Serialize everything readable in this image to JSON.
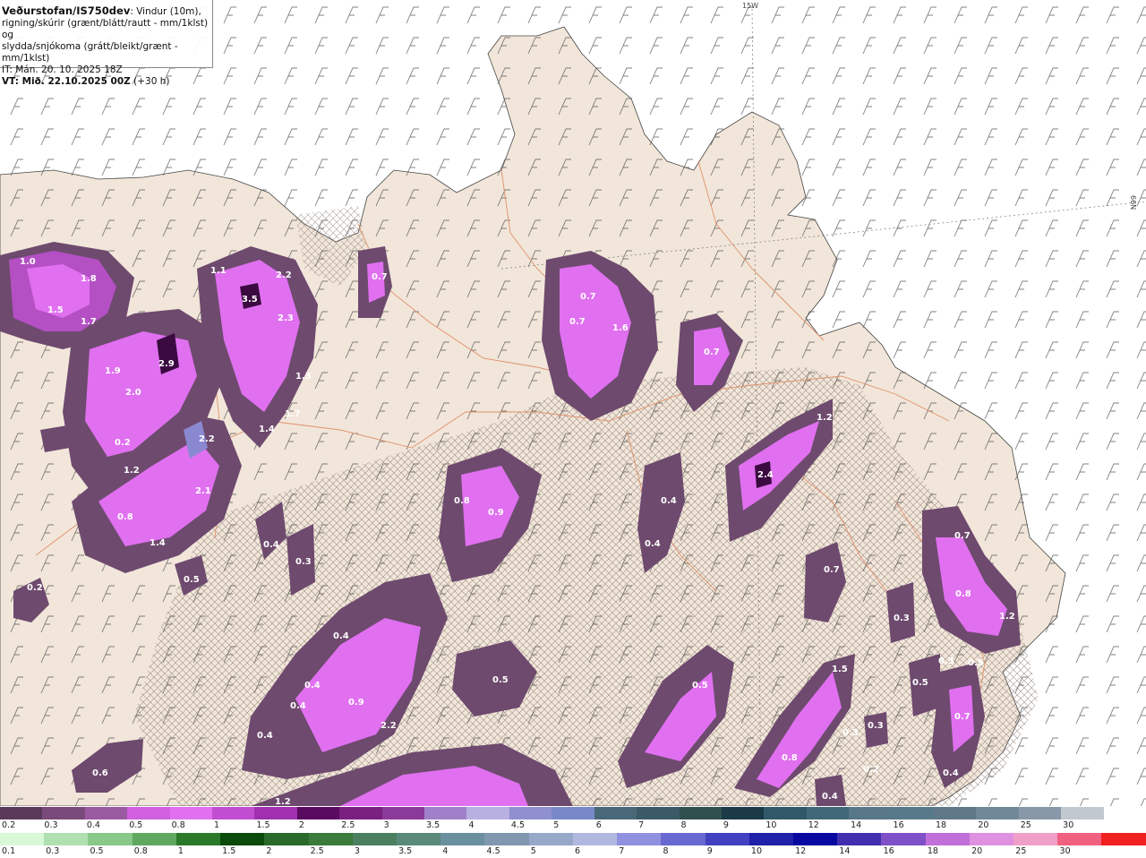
{
  "header": {
    "brand": "Veðurstofan/IS750dev",
    "desc_line1": ": Vindur (10m),",
    "desc_line2": "rigning/skúrir (grænt/blátt/rautt - mm/1klst) og",
    "desc_line3": "slydda/snjókoma (grátt/bleikt/grænt - mm/1klst)",
    "it_line": "IT: Mán. 20. 10. 2025 18Z",
    "vt_line": "VT: Mið. 22.10.2025 00Z",
    "lead": " (+30 h)"
  },
  "graticule": {
    "lon": "15W",
    "lat": "66N"
  },
  "colors": {
    "sea": "#ffffff",
    "land": "#f2e6da",
    "coast_land": "#e8d2bf",
    "roads": "#e0906a",
    "precip_light": "#6e4a6e",
    "precip_mid": "#a050a8",
    "precip_high": "#e060f0",
    "precip_peak": "#3a0a40"
  },
  "legend_precip": {
    "labels": [
      "0.2",
      "0.3",
      "0.4",
      "0.5",
      "0.8",
      "1",
      "1.5",
      "2",
      "2.5",
      "3",
      "3.5",
      "4",
      "4.5",
      "5",
      "6",
      "7",
      "8",
      "9",
      "10",
      "12",
      "14",
      "16",
      "18",
      "20",
      "25",
      "30"
    ],
    "colors": [
      "#5a3a5a",
      "#7a4a7a",
      "#9a5aa0",
      "#d060e0",
      "#e070f0",
      "#c04ed0",
      "#a030b0",
      "#5a0a60",
      "#7a2080",
      "#8a3a98",
      "#a080c8",
      "#b8b0e0",
      "#9090d0",
      "#7888c8",
      "#486878",
      "#3a5a68",
      "#305050",
      "#1a3a48",
      "#305868",
      "#406878",
      "#587888",
      "#587a88",
      "#607888",
      "#708898",
      "#8898a8",
      "#c0c8d0",
      "#ffffff"
    ]
  },
  "legend_rain": {
    "labels": [
      "0.1",
      "0.3",
      "0.5",
      "0.8",
      "1",
      "1.5",
      "2",
      "2.5",
      "3",
      "3.5",
      "4",
      "4.5",
      "5",
      "6",
      "7",
      "8",
      "9",
      "10",
      "12",
      "14",
      "16",
      "18",
      "20",
      "25",
      "30"
    ],
    "colors": [
      "#d8f8d8",
      "#b0e0b0",
      "#88c888",
      "#60a860",
      "#2a7a2a",
      "#0a4a0a",
      "#2a6a2a",
      "#3a7a3a",
      "#4a8060",
      "#5a8a7a",
      "#6a90a0",
      "#8098b0",
      "#98a8c8",
      "#b0b8e0",
      "#9090e0",
      "#6868d0",
      "#4040c0",
      "#2020a8",
      "#0808a0",
      "#4030b0",
      "#8050c8",
      "#c070d8",
      "#e090e0",
      "#f0a0c8",
      "#f06080",
      "#f02020"
    ]
  },
  "values": [
    {
      "label": "1.0"
    },
    {
      "label": "1.8"
    },
    {
      "label": "1.5"
    },
    {
      "label": "1.7"
    },
    {
      "label": "1.1"
    },
    {
      "label": "2.2"
    },
    {
      "label": "3.5"
    },
    {
      "label": "2.3"
    },
    {
      "label": "1.9"
    },
    {
      "label": "2.9"
    },
    {
      "label": "2.0"
    },
    {
      "label": "1.3"
    },
    {
      "label": "1.7"
    },
    {
      "label": "1.4"
    },
    {
      "label": "0.2"
    },
    {
      "label": "2.2"
    },
    {
      "label": "1.2"
    },
    {
      "label": "2.1"
    },
    {
      "label": "0.8"
    },
    {
      "label": "1.4"
    },
    {
      "label": "0.5"
    },
    {
      "label": "0.2"
    },
    {
      "label": "0.4"
    },
    {
      "label": "0.3"
    },
    {
      "label": "0.7"
    },
    {
      "label": "0.7"
    },
    {
      "label": "0.7"
    },
    {
      "label": "1.6"
    },
    {
      "label": "0.7"
    },
    {
      "label": "0.8"
    },
    {
      "label": "0.9"
    },
    {
      "label": "0.4"
    },
    {
      "label": "0.4"
    },
    {
      "label": "1.2"
    },
    {
      "label": "2.4"
    },
    {
      "label": "0.7"
    },
    {
      "label": "0.7"
    },
    {
      "label": "0.8"
    },
    {
      "label": "1.2"
    },
    {
      "label": "0.3"
    },
    {
      "label": "0.3"
    },
    {
      "label": "0.5"
    },
    {
      "label": "0.5"
    },
    {
      "label": "0.7"
    },
    {
      "label": "0.4"
    },
    {
      "label": "0.4"
    },
    {
      "label": "0.4"
    },
    {
      "label": "0.9"
    },
    {
      "label": "0.4"
    },
    {
      "label": "2.2"
    },
    {
      "label": "0.4"
    },
    {
      "label": "0.5"
    },
    {
      "label": "0.5"
    },
    {
      "label": "1.5"
    },
    {
      "label": "0.3"
    },
    {
      "label": "0.3"
    },
    {
      "label": "0.8"
    },
    {
      "label": "0.2"
    },
    {
      "label": "0.4"
    },
    {
      "label": "0.6"
    },
    {
      "label": "1.2"
    }
  ]
}
